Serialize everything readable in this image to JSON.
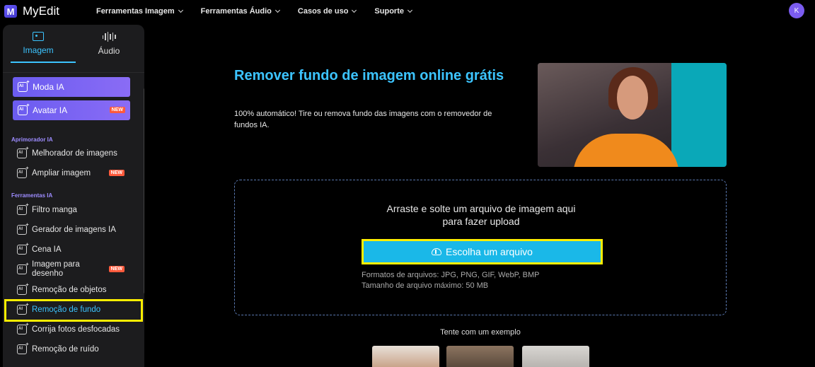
{
  "app": {
    "name": "MyEdit",
    "logo_letter": "M",
    "user_initial": "K"
  },
  "nav": [
    {
      "label": "Ferramentas Imagem"
    },
    {
      "label": "Ferramentas Áudio"
    },
    {
      "label": "Casos de uso"
    },
    {
      "label": "Suporte"
    }
  ],
  "sidebar": {
    "tabs": [
      {
        "label": "Imagem",
        "icon": "image-icon",
        "active": true
      },
      {
        "label": "Áudio",
        "icon": "audio-wave-icon",
        "active": false
      }
    ],
    "featured": [
      {
        "label": "Moda IA",
        "badge": ""
      },
      {
        "label": "Avatar IA",
        "badge": "NEW"
      }
    ],
    "sections": [
      {
        "title": "Aprimorador IA"
      },
      {
        "title": "Ferramentas IA"
      }
    ],
    "items": [
      {
        "label": "Melhorador de imagens",
        "badge": ""
      },
      {
        "label": "Ampliar imagem",
        "badge": "NEW"
      },
      {
        "label": "Filtro manga",
        "badge": ""
      },
      {
        "label": "Gerador de imagens IA",
        "badge": ""
      },
      {
        "label": "Cena IA",
        "badge": ""
      },
      {
        "label": "Imagem para desenho",
        "badge": "NEW"
      },
      {
        "label": "Remoção de objetos",
        "badge": ""
      },
      {
        "label": "Remoção de fundo",
        "badge": "",
        "active": true
      },
      {
        "label": "Corrija fotos desfocadas",
        "badge": ""
      },
      {
        "label": "Remoção de ruído",
        "badge": ""
      }
    ]
  },
  "hero": {
    "title": "Remover fundo de imagem online grátis",
    "subtitle": "100% automático! Tire ou remova fundo das imagens com o removedor de fundos IA."
  },
  "upload": {
    "prompt_line1": "Arraste e solte um arquivo de imagem aqui",
    "prompt_line2": "para fazer upload",
    "button_label": "Escolha um arquivo",
    "formats": "Formatos de arquivos: JPG, PNG, GIF, WebP, BMP",
    "max_size": "Tamanho de arquivo máximo: 50 MB"
  },
  "examples": {
    "label": "Tente com um exemplo"
  },
  "colors": {
    "accent": "#3cc4ff",
    "brand": "#6b5cf0",
    "highlight": "#ffee00",
    "button": "#1ab8e8",
    "new_badge": "#ff5a3c"
  }
}
